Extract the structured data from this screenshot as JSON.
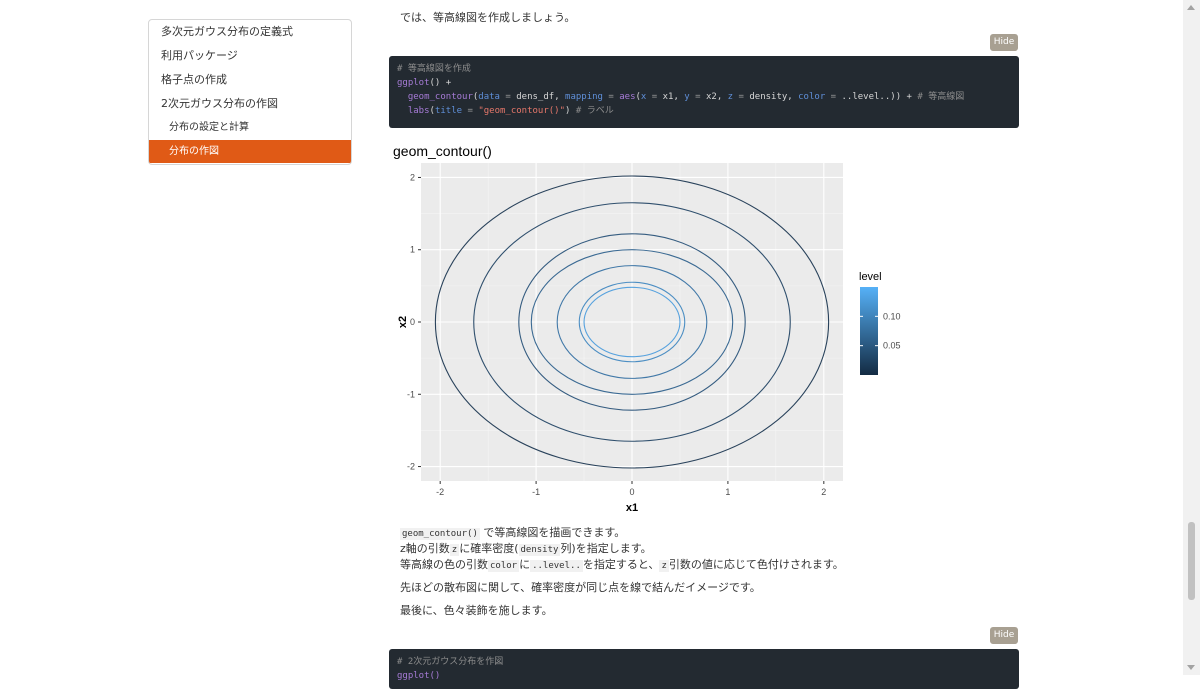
{
  "toc": {
    "items": [
      {
        "label": "多次元ガウス分布の定義式",
        "level": 1,
        "active": false
      },
      {
        "label": "利用パッケージ",
        "level": 1,
        "active": false
      },
      {
        "label": "格子点の作成",
        "level": 1,
        "active": false
      },
      {
        "label": "2次元ガウス分布の作図",
        "level": 1,
        "active": false
      },
      {
        "label": "分布の設定と計算",
        "level": 2,
        "active": false
      },
      {
        "label": "分布の作図",
        "level": 2,
        "active": true
      }
    ]
  },
  "intro_text": "では、等高線図を作成しましょう。",
  "hide_label": "Hide",
  "code1": {
    "comment": "# 等高線図を作成",
    "l2_fn": "ggplot",
    "l2_rest": "() +",
    "l3_fn": "geom_contour",
    "l3_data_kw": "data",
    "l3_eq": " = ",
    "l3_data_val": "dens_df",
    "l3_map_kw": "mapping",
    "l3_aes": "aes",
    "l3_x_kw": "x",
    "l3_x_val": "x1",
    "l3_y_kw": "y",
    "l3_y_val": "x2",
    "l3_z_kw": "z",
    "l3_z_val": "density",
    "l3_col_kw": "color",
    "l3_col_val": "..level..",
    "l3_tail": ")) + ",
    "l3_comment": "# 等高線図",
    "l4_fn": "labs",
    "l4_title_kw": "title",
    "l4_title_val": "\"geom_contour()\"",
    "l4_tail": ") ",
    "l4_comment": "# ラベル"
  },
  "chart_data": {
    "type": "contour",
    "title": "geom_contour()",
    "xlabel": "x1",
    "ylabel": "x2",
    "xlim": [
      -2.2,
      2.2
    ],
    "ylim": [
      -2.2,
      2.2
    ],
    "xticks": [
      -2,
      -1,
      0,
      1,
      2
    ],
    "yticks": [
      -2,
      -1,
      0,
      1,
      2
    ],
    "legend_title": "level",
    "legend_ticks": [
      0.05,
      0.1
    ],
    "legend_range": [
      0.0,
      0.15
    ],
    "legend_position": "right",
    "contours": [
      {
        "level": 0.02,
        "rx": 2.05,
        "ry": 2.02,
        "color": "#29425b"
      },
      {
        "level": 0.04,
        "rx": 1.65,
        "ry": 1.65,
        "color": "#2f4f6d"
      },
      {
        "level": 0.06,
        "rx": 1.18,
        "ry": 1.22,
        "color": "#355c80"
      },
      {
        "level": 0.08,
        "rx": 1.05,
        "ry": 1.0,
        "color": "#3b6a93"
      },
      {
        "level": 0.1,
        "rx": 0.78,
        "ry": 0.78,
        "color": "#4279a8"
      },
      {
        "level": 0.12,
        "rx": 0.55,
        "ry": 0.55,
        "color": "#4c8ec3"
      },
      {
        "level": 0.14,
        "rx": 0.5,
        "ry": 0.48,
        "color": "#57a2de"
      }
    ],
    "colors": {
      "panel": "#ebebeb",
      "grid": "#ffffff",
      "low": "#132b43",
      "high": "#56b1f7"
    }
  },
  "desc": {
    "line1_code": "geom_contour()",
    "line1_text": " で等高線図を描画できます。",
    "line2_a": "z軸の引数",
    "line2_code1": "z",
    "line2_b": "に確率密度(",
    "line2_code2": "density",
    "line2_c": "列)を指定します。",
    "line3_a": "等高線の色の引数",
    "line3_code1": "color",
    "line3_b": "に",
    "line3_code2": "..level..",
    "line3_c": "を指定すると、",
    "line3_code3": "z",
    "line3_d": "引数の値に応じて色付けされます。",
    "para2": "先ほどの散布図に関して、確率密度が同じ点を線で結んだイメージです。",
    "para3": "最後に、色々装飾を施します。"
  },
  "code2": {
    "comment": "# 2次元ガウス分布を作図",
    "l2_partial": "ggplot()"
  }
}
